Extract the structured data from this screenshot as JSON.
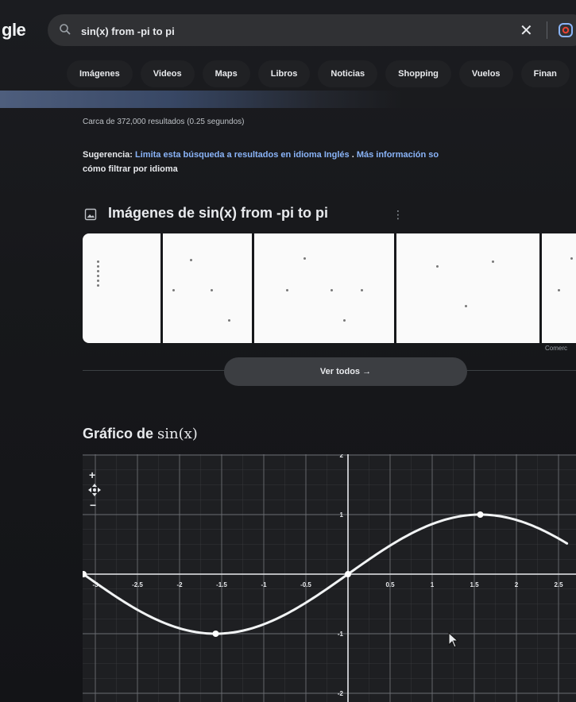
{
  "header": {
    "logo_text": "gle",
    "search_value": "sin(x) from -pi to pi",
    "icons": {
      "search": "search-icon",
      "clear": "close-icon",
      "lens": "google-lens-icon"
    }
  },
  "tabs": [
    "Imágenes",
    "Videos",
    "Maps",
    "Libros",
    "Noticias",
    "Shopping",
    "Vuelos",
    "Finan"
  ],
  "results": {
    "stats": "Carca de 372,000 resultados (0.25 segundos)",
    "suggestion_prefix": "Sugerencia:",
    "suggestion_link": "Limita esta búsqueda a resultados en idioma",
    "suggestion_lang": "Inglés",
    "suggestion_dot": ".",
    "suggestion_more": "Más información so",
    "suggestion_line2": "cómo filtrar por idioma"
  },
  "images": {
    "heading": "Imágenes de sin(x) from -pi to pi",
    "more": "⋮",
    "caption": "Comerc",
    "see_all": "Ver todos →"
  },
  "graph": {
    "title_prefix": "Gráfico de",
    "title_math": "sin(x)",
    "zoom_in": "+",
    "zoom_out": "−",
    "curve_color": "#f1f3f4",
    "grid_color": "#4a4c50"
  },
  "chart_data": {
    "type": "line",
    "title": "",
    "xlabel": "",
    "ylabel": "",
    "xlim": [
      -3.14159,
      2.6
    ],
    "ylim": [
      -2,
      2
    ],
    "x_ticks": [
      -3,
      -2.5,
      -2,
      -1.5,
      -1,
      -0.5,
      0.5,
      1,
      1.5,
      2,
      2.5
    ],
    "x_tick_labels": [
      "-3",
      "-2.5",
      "-2",
      "-1.5",
      "-1",
      "-0.5",
      "0.5",
      "1",
      "1.5",
      "2",
      "2.5"
    ],
    "y_ticks": [
      2,
      1,
      -1,
      -2
    ],
    "y_tick_labels": [
      "2",
      "1",
      "-1",
      "-2"
    ],
    "series": [
      {
        "x": [
          -3.14159,
          -2.8,
          -2.4,
          -2.0,
          -1.5708,
          -1.2,
          -0.8,
          -0.4,
          0,
          0.4,
          0.8,
          1.2,
          1.5708,
          2.0,
          2.4,
          2.6
        ],
        "y": [
          0,
          -0.335,
          -0.675,
          -0.909,
          -1,
          -0.932,
          -0.717,
          -0.389,
          0,
          0.389,
          0.717,
          0.932,
          1,
          0.909,
          0.675,
          0.516
        ]
      }
    ],
    "marked_points": [
      {
        "x": -3.14159,
        "y": 0
      },
      {
        "x": -1.5708,
        "y": -1
      },
      {
        "x": 0,
        "y": 0
      },
      {
        "x": 1.5708,
        "y": 1
      }
    ],
    "grid": true
  }
}
